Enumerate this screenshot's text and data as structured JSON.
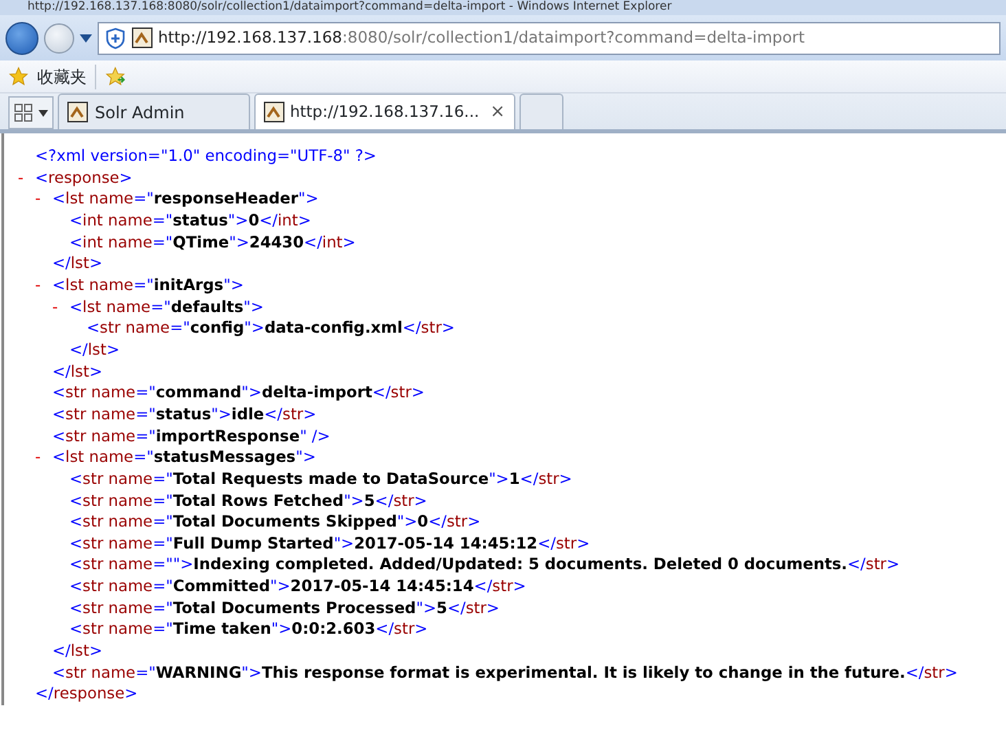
{
  "window": {
    "title": "http://192.168.137.168:8080/solr/collection1/dataimport?command=delta-import - Windows Internet Explorer"
  },
  "address_bar": {
    "host": "http://192.168.137.168",
    "rest": ":8080/solr/collection1/dataimport?command=delta-import"
  },
  "favorites_bar": {
    "label": "收藏夹"
  },
  "tabs": [
    {
      "label": "Solr Admin",
      "selected": false
    },
    {
      "label": "http://192.168.137.16...",
      "selected": true,
      "close": "×"
    }
  ],
  "document": [
    {
      "kind": "declaration",
      "text": "<?xml version=\"1.0\" encoding=\"UTF-8\" ?>"
    },
    {
      "kind": "parent",
      "toggle": "-",
      "text": "<response>",
      "close": "</response>",
      "children": [
        {
          "kind": "parent",
          "toggle": "-",
          "text": "<lst name=\"**responseHeader**\">",
          "close": "</lst>",
          "children": [
            {
              "kind": "leaf",
              "text": "<int name=\"**status**\">**0**</int>"
            },
            {
              "kind": "leaf",
              "text": "<int name=\"**QTime**\">**24430**</int>"
            }
          ]
        },
        {
          "kind": "parent",
          "toggle": "-",
          "text": "<lst name=\"**initArgs**\">",
          "close": "</lst>",
          "children": [
            {
              "kind": "parent",
              "toggle": "-",
              "text": "<lst name=\"**defaults**\">",
              "close": "</lst>",
              "children": [
                {
                  "kind": "leaf",
                  "text": "<str name=\"**config**\">**data-config.xml**</str>"
                }
              ]
            }
          ]
        },
        {
          "kind": "leaf",
          "text": "<str name=\"**command**\">**delta-import**</str>"
        },
        {
          "kind": "leaf",
          "text": "<str name=\"**status**\">**idle**</str>"
        },
        {
          "kind": "leaf",
          "text": "<str name=\"**importResponse**\" />"
        },
        {
          "kind": "parent",
          "toggle": "-",
          "text": "<lst name=\"**statusMessages**\">",
          "close": "</lst>",
          "children": [
            {
              "kind": "leaf",
              "text": "<str name=\"**Total Requests made to DataSource**\">**1**</str>"
            },
            {
              "kind": "leaf",
              "text": "<str name=\"**Total Rows Fetched**\">**5**</str>"
            },
            {
              "kind": "leaf",
              "text": "<str name=\"**Total Documents Skipped**\">**0**</str>"
            },
            {
              "kind": "leaf",
              "text": "<str name=\"**Full Dump Started**\">**2017-05-14 14:45:12**</str>"
            },
            {
              "kind": "leaf",
              "text": "<str name=\"\">**Indexing completed. Added/Updated: 5 documents. Deleted 0 documents.**</str>"
            },
            {
              "kind": "leaf",
              "text": "<str name=\"**Committed**\">**2017-05-14 14:45:14**</str>"
            },
            {
              "kind": "leaf",
              "text": "<str name=\"**Total Documents Processed**\">**5**</str>"
            },
            {
              "kind": "leaf",
              "text": "<str name=\"**Time taken**\">**0:0:2.603**</str>"
            }
          ]
        },
        {
          "kind": "leaf",
          "text": "<str name=\"**WARNING**\">**This response format is experimental. It is likely to change in the future.**</str>"
        }
      ]
    }
  ]
}
